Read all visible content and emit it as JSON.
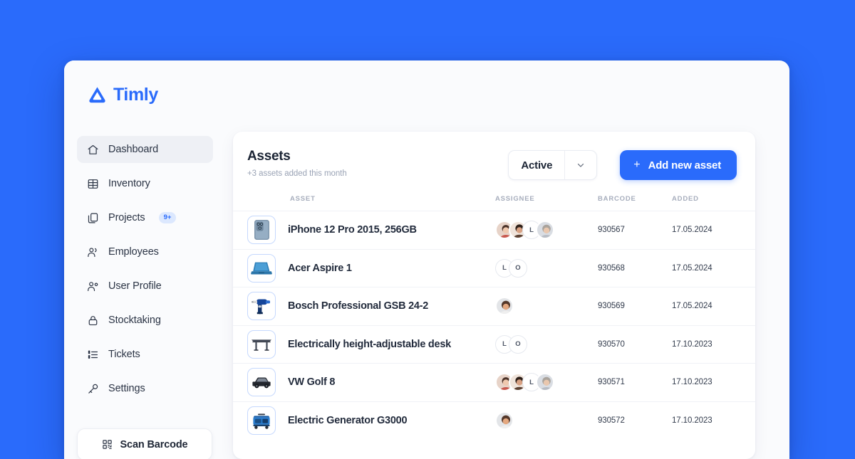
{
  "theme": {
    "background": "#2a6bfb",
    "accent": "#2a6bfb",
    "window_bg": "#fafbfd",
    "card_bg": "#ffffff",
    "text_primary": "#1b2434",
    "text_muted": "#9aa3b5",
    "badge_bg": "#dce8fe"
  },
  "sidebar": {
    "brand": {
      "name": "Timly",
      "logo_icon": "timly-logo-icon"
    },
    "items": [
      {
        "label": "Dashboard",
        "icon": "home-icon",
        "active": true,
        "badge": null
      },
      {
        "label": "Inventory",
        "icon": "grid-icon",
        "active": false,
        "badge": null
      },
      {
        "label": "Projects",
        "icon": "copy-icon",
        "active": false,
        "badge": "9+"
      },
      {
        "label": "Employees",
        "icon": "users-icon",
        "active": false,
        "badge": null
      },
      {
        "label": "User Profile",
        "icon": "user-gear-icon",
        "active": false,
        "badge": null
      },
      {
        "label": "Stocktaking",
        "icon": "lock-icon",
        "active": false,
        "badge": null
      },
      {
        "label": "Tickets",
        "icon": "list-icon",
        "active": false,
        "badge": null
      },
      {
        "label": "Settings",
        "icon": "key-icon",
        "active": false,
        "badge": null
      }
    ],
    "scan_button": {
      "label": "Scan Barcode",
      "icon": "qr-code-icon"
    }
  },
  "main": {
    "title": "Assets",
    "subtitle": "+3 assets added this month",
    "filter": {
      "value": "Active",
      "caret_icon": "chevron-down-icon"
    },
    "add_button": {
      "label": "Add new asset",
      "plus": "+"
    },
    "columns": [
      "ASSET",
      "ASSIGNEE",
      "BARCODE",
      "ADDED"
    ],
    "rows": [
      {
        "name": "iPhone 12 Pro 2015, 256GB",
        "thumb_icon": "iphone-thumb-icon",
        "assignees": [
          {
            "type": "photo",
            "tone": "p1"
          },
          {
            "type": "photo",
            "tone": "p2"
          },
          {
            "type": "initial",
            "label": "L"
          },
          {
            "type": "photo",
            "tone": "p3"
          }
        ],
        "barcode": "930567",
        "added": "17.05.2024"
      },
      {
        "name": "Acer Aspire 1",
        "thumb_icon": "laptop-thumb-icon",
        "assignees": [
          {
            "type": "initial",
            "label": "L"
          },
          {
            "type": "initial",
            "label": "O"
          }
        ],
        "barcode": "930568",
        "added": "17.05.2024"
      },
      {
        "name": "Bosch Professional GSB 24-2",
        "thumb_icon": "drill-thumb-icon",
        "assignees": [
          {
            "type": "photo",
            "tone": "p4"
          }
        ],
        "barcode": "930569",
        "added": "17.05.2024"
      },
      {
        "name": "Electrically height-adjustable desk",
        "thumb_icon": "desk-thumb-icon",
        "assignees": [
          {
            "type": "initial",
            "label": "L"
          },
          {
            "type": "initial",
            "label": "O"
          }
        ],
        "barcode": "930570",
        "added": "17.10.2023"
      },
      {
        "name": "VW Golf 8",
        "thumb_icon": "car-thumb-icon",
        "assignees": [
          {
            "type": "photo",
            "tone": "p1"
          },
          {
            "type": "photo",
            "tone": "p2"
          },
          {
            "type": "initial",
            "label": "L"
          },
          {
            "type": "photo",
            "tone": "p3"
          }
        ],
        "barcode": "930571",
        "added": "17.10.2023"
      },
      {
        "name": "Electric Generator G3000",
        "thumb_icon": "generator-thumb-icon",
        "assignees": [
          {
            "type": "photo",
            "tone": "p4"
          }
        ],
        "barcode": "930572",
        "added": "17.10.2023"
      }
    ]
  }
}
